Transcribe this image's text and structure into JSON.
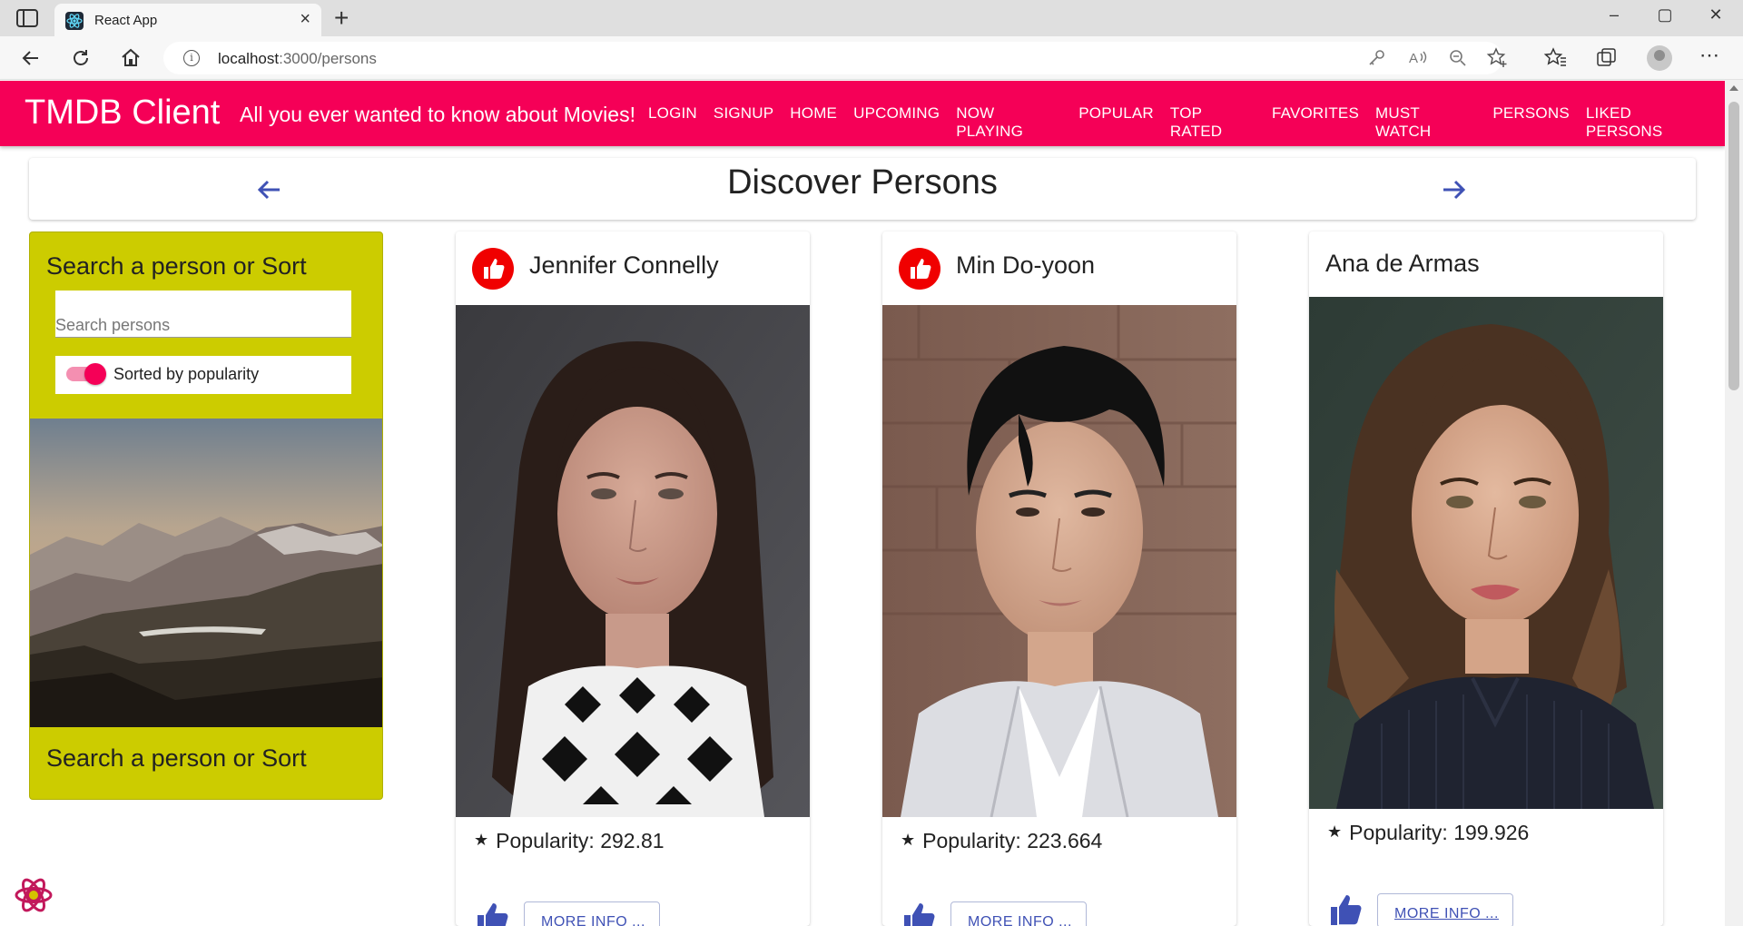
{
  "browser": {
    "tab_title": "React App",
    "tab_close": "×",
    "new_tab": "+",
    "url_host": "localhost",
    "url_rest": ":3000/persons",
    "window_controls": [
      "–",
      "▢",
      "✕"
    ],
    "menu": "⋯"
  },
  "app": {
    "brand": "TMDB Client",
    "tagline": "All you ever wanted to know about Movies!",
    "nav": [
      "LOGIN",
      "SIGNUP",
      "HOME",
      "UPCOMING",
      "NOW PLAYING",
      "POPULAR",
      "TOP RATED",
      "FAVORITES",
      "MUST WATCH",
      "PERSONS",
      "LIKED PERSONS"
    ]
  },
  "page": {
    "title": "Discover Persons"
  },
  "filter": {
    "title": "Search a person or Sort",
    "search_placeholder": "Search persons",
    "search_value": "",
    "sort_label": "Sorted by popularity",
    "sort_on": true,
    "footer_title": "Search a person or Sort"
  },
  "persons": [
    {
      "name": "Jennifer Connelly",
      "popularity_label": "Popularity: 292.81",
      "liked": true,
      "more_label": "MORE INFO ..."
    },
    {
      "name": "Min Do-yoon",
      "popularity_label": "Popularity: 223.664",
      "liked": true,
      "more_label": "MORE INFO ..."
    },
    {
      "name": "Ana de Armas",
      "popularity_label": "Popularity: 199.926",
      "liked": false,
      "more_label": "MORE INFO ..."
    }
  ],
  "star_glyph": "★",
  "colors": {
    "appbar": "#f50057",
    "filter_card": "#cccc00",
    "avatar": "#f00000",
    "primary": "#3f51b5"
  }
}
